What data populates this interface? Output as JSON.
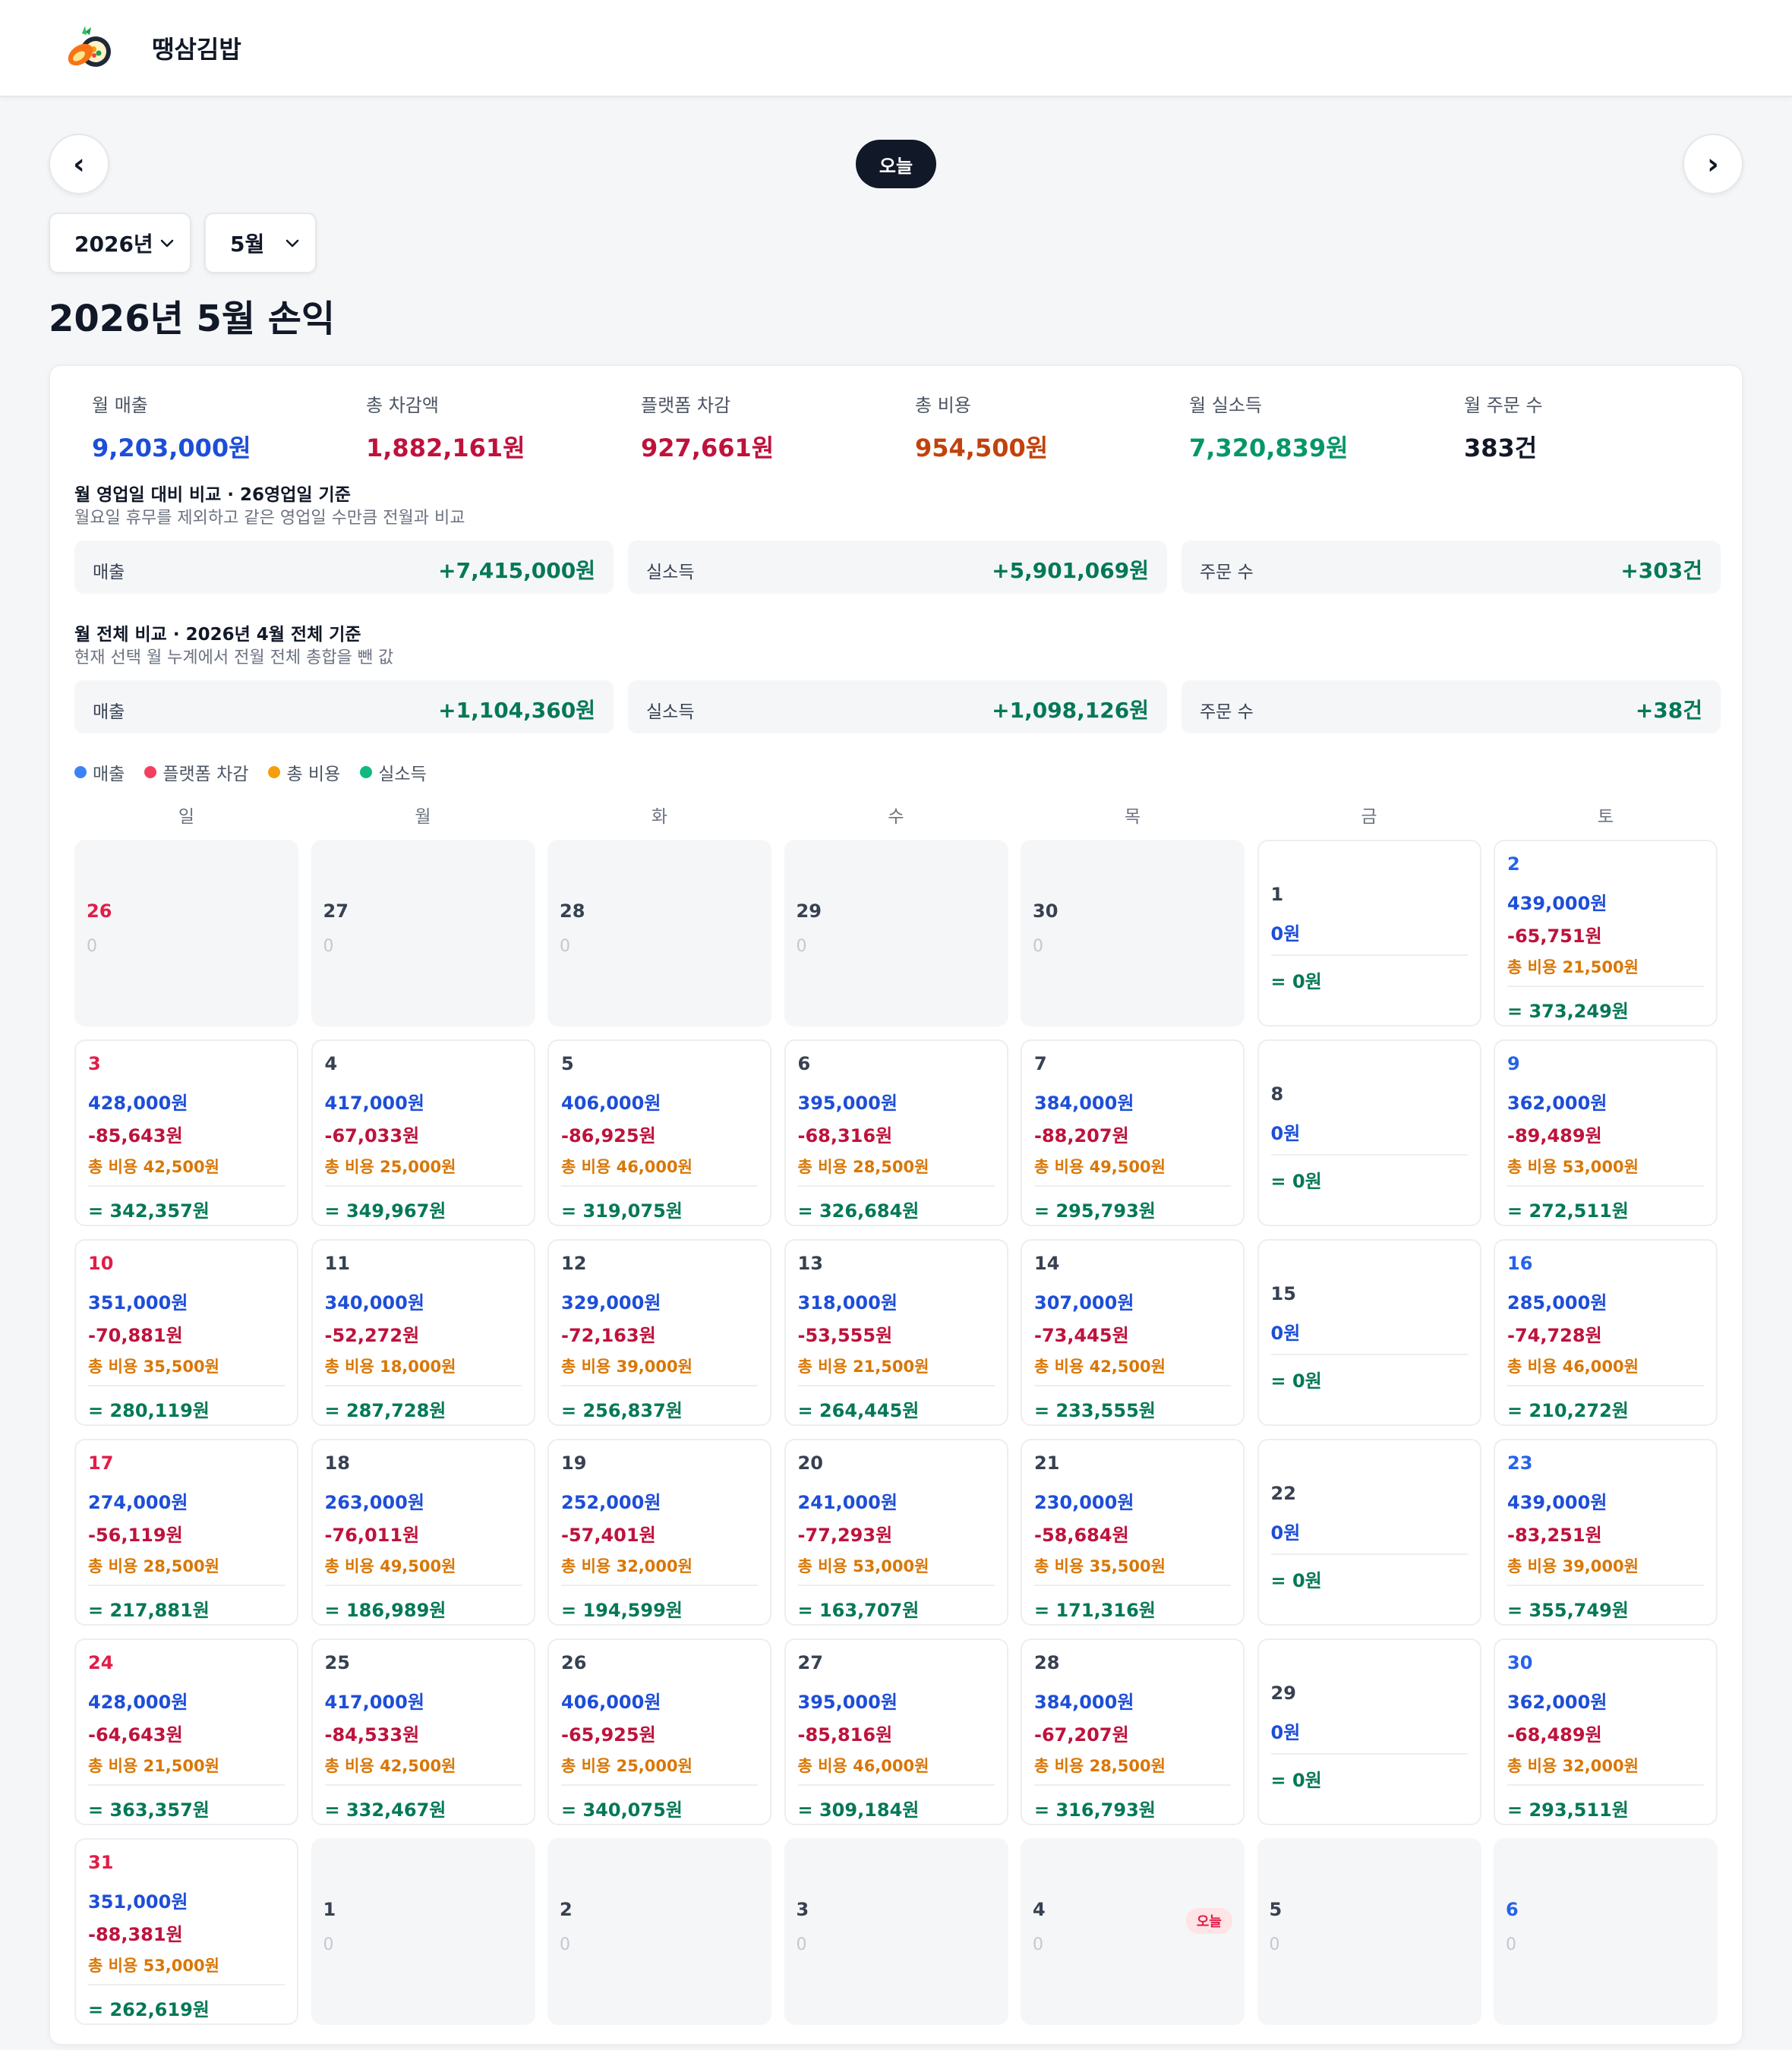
{
  "brand": {
    "name": "땡삼김밥"
  },
  "nav": {
    "prev": "‹",
    "next": "›",
    "today": "오늘"
  },
  "selects": {
    "year": "2026년",
    "month": "5월"
  },
  "title": "2026년 5월 손익",
  "summary": [
    {
      "label": "월 매출",
      "value": "9,203,000원",
      "color": "#1d4ed8"
    },
    {
      "label": "총 차감액",
      "value": "1,882,161원",
      "color": "#be123c"
    },
    {
      "label": "플랫폼 차감",
      "value": "927,661원",
      "color": "#be123c"
    },
    {
      "label": "총 비용",
      "value": "954,500원",
      "color": "#c2410c"
    },
    {
      "label": "월 실소득",
      "value": "7,320,839원",
      "color": "#059669"
    },
    {
      "label": "월 주문 수",
      "value": "383건",
      "color": "#111827"
    }
  ],
  "compare_business": {
    "title": "월 영업일 대비 비교 · 26영업일 기준",
    "sub": "월요일 휴무를 제외하고 같은 영업일 수만큼 전월과 비교",
    "items": [
      {
        "label": "매출",
        "value": "+7,415,000원"
      },
      {
        "label": "실소득",
        "value": "+5,901,069원"
      },
      {
        "label": "주문 수",
        "value": "+303건"
      }
    ]
  },
  "compare_full": {
    "title": "월 전체 비교 · 2026년 4월 전체 기준",
    "sub": "현재 선택 월 누계에서 전월 전체 총합을 뺀 값",
    "items": [
      {
        "label": "매출",
        "value": "+1,104,360원"
      },
      {
        "label": "실소득",
        "value": "+1,098,126원"
      },
      {
        "label": "주문 수",
        "value": "+38건"
      }
    ]
  },
  "legend": [
    {
      "label": "매출",
      "color": "#3b82f6"
    },
    {
      "label": "플랫폼 차감",
      "color": "#f43f5e"
    },
    {
      "label": "총 비용",
      "color": "#f59e0b"
    },
    {
      "label": "실소득",
      "color": "#10b981"
    }
  ],
  "weekdays": [
    "일",
    "월",
    "화",
    "수",
    "목",
    "금",
    "토"
  ],
  "today_badge": "오늘",
  "days": [
    {
      "d": "26",
      "t": "out",
      "zero": "0"
    },
    {
      "d": "27",
      "t": "out",
      "zero": "0"
    },
    {
      "d": "28",
      "t": "out",
      "zero": "0"
    },
    {
      "d": "29",
      "t": "out",
      "zero": "0"
    },
    {
      "d": "30",
      "t": "out",
      "zero": "0"
    },
    {
      "d": "1",
      "t": "zero",
      "rev": "0원",
      "net": "= 0원"
    },
    {
      "d": "2",
      "t": "full",
      "rev": "439,000원",
      "ded": "-65,751원",
      "cost": "총 비용 21,500원",
      "net": "= 373,249원"
    },
    {
      "d": "3",
      "t": "full",
      "rev": "428,000원",
      "ded": "-85,643원",
      "cost": "총 비용 42,500원",
      "net": "= 342,357원"
    },
    {
      "d": "4",
      "t": "full",
      "rev": "417,000원",
      "ded": "-67,033원",
      "cost": "총 비용 25,000원",
      "net": "= 349,967원"
    },
    {
      "d": "5",
      "t": "full",
      "rev": "406,000원",
      "ded": "-86,925원",
      "cost": "총 비용 46,000원",
      "net": "= 319,075원"
    },
    {
      "d": "6",
      "t": "full",
      "rev": "395,000원",
      "ded": "-68,316원",
      "cost": "총 비용 28,500원",
      "net": "= 326,684원"
    },
    {
      "d": "7",
      "t": "full",
      "rev": "384,000원",
      "ded": "-88,207원",
      "cost": "총 비용 49,500원",
      "net": "= 295,793원"
    },
    {
      "d": "8",
      "t": "zero",
      "rev": "0원",
      "net": "= 0원"
    },
    {
      "d": "9",
      "t": "full",
      "rev": "362,000원",
      "ded": "-89,489원",
      "cost": "총 비용 53,000원",
      "net": "= 272,511원"
    },
    {
      "d": "10",
      "t": "full",
      "rev": "351,000원",
      "ded": "-70,881원",
      "cost": "총 비용 35,500원",
      "net": "= 280,119원"
    },
    {
      "d": "11",
      "t": "full",
      "rev": "340,000원",
      "ded": "-52,272원",
      "cost": "총 비용 18,000원",
      "net": "= 287,728원"
    },
    {
      "d": "12",
      "t": "full",
      "rev": "329,000원",
      "ded": "-72,163원",
      "cost": "총 비용 39,000원",
      "net": "= 256,837원"
    },
    {
      "d": "13",
      "t": "full",
      "rev": "318,000원",
      "ded": "-53,555원",
      "cost": "총 비용 21,500원",
      "net": "= 264,445원"
    },
    {
      "d": "14",
      "t": "full",
      "rev": "307,000원",
      "ded": "-73,445원",
      "cost": "총 비용 42,500원",
      "net": "= 233,555원"
    },
    {
      "d": "15",
      "t": "zero",
      "rev": "0원",
      "net": "= 0원"
    },
    {
      "d": "16",
      "t": "full",
      "rev": "285,000원",
      "ded": "-74,728원",
      "cost": "총 비용 46,000원",
      "net": "= 210,272원"
    },
    {
      "d": "17",
      "t": "full",
      "rev": "274,000원",
      "ded": "-56,119원",
      "cost": "총 비용 28,500원",
      "net": "= 217,881원"
    },
    {
      "d": "18",
      "t": "full",
      "rev": "263,000원",
      "ded": "-76,011원",
      "cost": "총 비용 49,500원",
      "net": "= 186,989원"
    },
    {
      "d": "19",
      "t": "full",
      "rev": "252,000원",
      "ded": "-57,401원",
      "cost": "총 비용 32,000원",
      "net": "= 194,599원"
    },
    {
      "d": "20",
      "t": "full",
      "rev": "241,000원",
      "ded": "-77,293원",
      "cost": "총 비용 53,000원",
      "net": "= 163,707원"
    },
    {
      "d": "21",
      "t": "full",
      "rev": "230,000원",
      "ded": "-58,684원",
      "cost": "총 비용 35,500원",
      "net": "= 171,316원"
    },
    {
      "d": "22",
      "t": "zero",
      "rev": "0원",
      "net": "= 0원"
    },
    {
      "d": "23",
      "t": "full",
      "rev": "439,000원",
      "ded": "-83,251원",
      "cost": "총 비용 39,000원",
      "net": "= 355,749원"
    },
    {
      "d": "24",
      "t": "full",
      "rev": "428,000원",
      "ded": "-64,643원",
      "cost": "총 비용 21,500원",
      "net": "= 363,357원"
    },
    {
      "d": "25",
      "t": "full",
      "rev": "417,000원",
      "ded": "-84,533원",
      "cost": "총 비용 42,500원",
      "net": "= 332,467원"
    },
    {
      "d": "26",
      "t": "full",
      "rev": "406,000원",
      "ded": "-65,925원",
      "cost": "총 비용 25,000원",
      "net": "= 340,075원"
    },
    {
      "d": "27",
      "t": "full",
      "rev": "395,000원",
      "ded": "-85,816원",
      "cost": "총 비용 46,000원",
      "net": "= 309,184원"
    },
    {
      "d": "28",
      "t": "full",
      "rev": "384,000원",
      "ded": "-67,207원",
      "cost": "총 비용 28,500원",
      "net": "= 316,793원"
    },
    {
      "d": "29",
      "t": "zero",
      "rev": "0원",
      "net": "= 0원"
    },
    {
      "d": "30",
      "t": "full",
      "rev": "362,000원",
      "ded": "-68,489원",
      "cost": "총 비용 32,000원",
      "net": "= 293,511원"
    },
    {
      "d": "31",
      "t": "full",
      "rev": "351,000원",
      "ded": "-88,381원",
      "cost": "총 비용 53,000원",
      "net": "= 262,619원"
    },
    {
      "d": "1",
      "t": "out",
      "zero": "0"
    },
    {
      "d": "2",
      "t": "out",
      "zero": "0"
    },
    {
      "d": "3",
      "t": "out",
      "zero": "0"
    },
    {
      "d": "4",
      "t": "out",
      "zero": "0",
      "today": true
    },
    {
      "d": "5",
      "t": "out",
      "zero": "0"
    },
    {
      "d": "6",
      "t": "out",
      "zero": "0"
    }
  ]
}
